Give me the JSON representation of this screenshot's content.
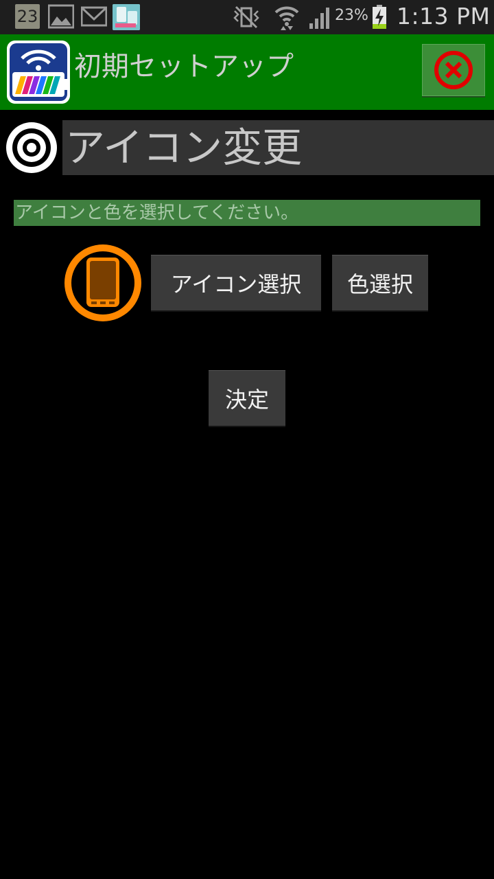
{
  "status_bar": {
    "notification_date": "23",
    "battery_percent": "23%",
    "time": "1:13 PM",
    "icons": [
      "calendar-icon",
      "gallery-icon",
      "mail-icon",
      "app-notification-icon",
      "vibrate-icon",
      "wifi-icon",
      "signal-icon",
      "battery-charging-icon"
    ]
  },
  "title_bar": {
    "title": "初期セットアップ",
    "background_color": "#007c00",
    "logo_icon": "wifi-battery-app-logo",
    "close_icon": "close-icon",
    "close_color": "#e00000"
  },
  "section": {
    "icon": "target-icon",
    "title": "アイコン変更"
  },
  "instruction": {
    "text": "アイコンと色を選択してください。"
  },
  "icon_preview": {
    "icon": "smartphone-icon",
    "ring_color": "#ff8800",
    "fill_color": "#7a3f00"
  },
  "buttons": {
    "icon_select": "アイコン選択",
    "color_select": "色選択",
    "confirm": "決定"
  }
}
